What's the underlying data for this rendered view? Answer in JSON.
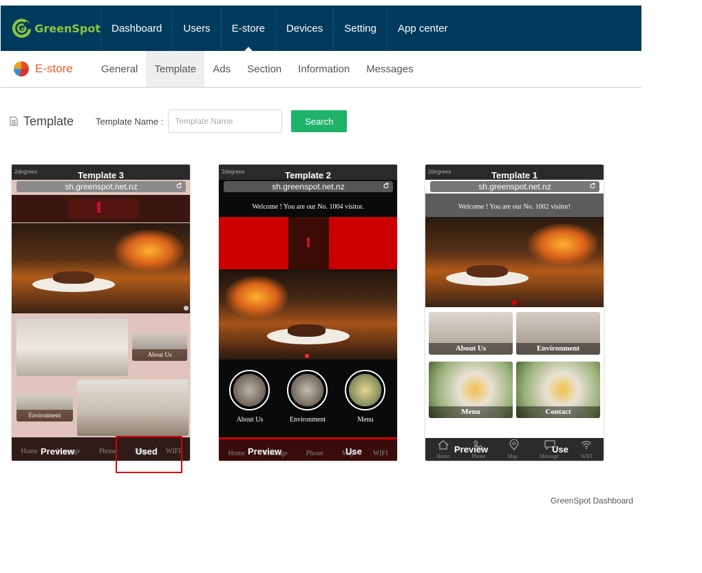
{
  "nav": {
    "brand": "GreenSpot",
    "items": [
      "Dashboard",
      "Users",
      "E-store",
      "Devices",
      "Setting",
      "App center"
    ],
    "active_index": 2
  },
  "subnav": {
    "brand": "E-store",
    "items": [
      "General",
      "Template",
      "Ads",
      "Section",
      "Information",
      "Messages"
    ],
    "active_index": 1
  },
  "page": {
    "title": "Template",
    "name_label": "Template Name :",
    "name_placeholder": "Template Name",
    "search_label": "Search"
  },
  "templates": [
    {
      "title": "Template 3",
      "status": "2degrees",
      "url": "sh.greenspot.net.nz",
      "tiles": [
        "About Us",
        "Environment"
      ],
      "bottom_labels": [
        "Home",
        "Message",
        "Phone",
        "Map",
        "WIFI"
      ],
      "preview": "Preview",
      "action": "Used"
    },
    {
      "title": "Template 2",
      "status": "2degrees",
      "url": "sh.greenspot.net.nz",
      "welcome": "Welcome ! You are our No. 1004 visitor.",
      "circles": [
        "About Us",
        "Environment",
        "Menu"
      ],
      "bottom_labels": [
        "Home",
        "Message",
        "Phone",
        "Map",
        "WIFI"
      ],
      "preview": "Preview",
      "action": "Use"
    },
    {
      "title": "Template 1",
      "status": "2degrees",
      "url": "sh.greenspot.net.nz",
      "welcome": "Welcome ! You are our No. 1002 visitor!",
      "tiles": [
        "About Us",
        "Environment",
        "Menu",
        "Contact"
      ],
      "bottom_labels": [
        "Home",
        "Phone",
        "Map",
        "Message",
        "WIFI"
      ],
      "preview": "Preview",
      "action": "Use"
    }
  ],
  "footer": "GreenSpot Dashboard",
  "colors": {
    "nav_bg": "#003a5c",
    "brand_green": "#8cc63f",
    "estore_orange": "#e8602c",
    "search_green": "#1fb26b",
    "used_highlight": "#e00000"
  },
  "icons": [
    "greenspot-logo-icon",
    "pie-chart-icon",
    "document-icon",
    "reload-icon",
    "home-icon",
    "phone-icon",
    "map-pin-icon",
    "message-icon",
    "wifi-icon"
  ]
}
